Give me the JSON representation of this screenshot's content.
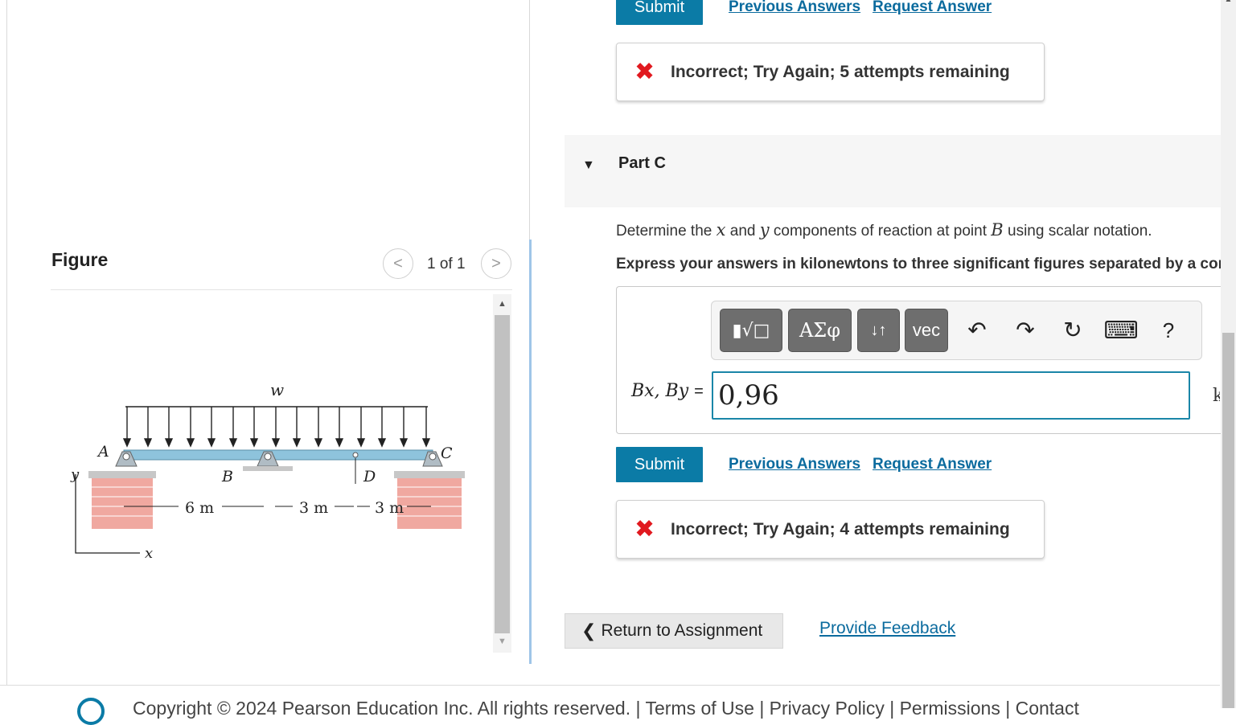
{
  "figure": {
    "title": "Figure",
    "counter": "1 of 1",
    "prev_icon": "<",
    "next_icon": ">",
    "diagram_labels": {
      "load": "w",
      "point_a": "A",
      "point_b": "B",
      "point_c": "C",
      "point_d": "D",
      "axis_y": "y",
      "axis_x": "x",
      "dim_1": "6 m",
      "dim_2": "3 m",
      "dim_3": "3 m"
    }
  },
  "part_b": {
    "submit_label": "Submit",
    "previous_answers": "Previous Answers",
    "request_answer": "Request Answer",
    "feedback_icon": "✖",
    "feedback_text": "Incorrect; Try Again; 5 attempts remaining"
  },
  "part_c": {
    "caret": "▼",
    "title": "Part C",
    "question_pre": "Determine the ",
    "var_x": "x",
    "question_and": " and ",
    "var_y": "y",
    "question_mid": " components of reaction at point ",
    "var_b": "B",
    "question_post": " using scalar notation.",
    "instruction": "Express your answers in kilonewtons to three significant figures separated by a comma.",
    "toolbar": {
      "templates_label": "▮√□",
      "greek_label": "ΑΣφ",
      "updown_label": "↓↑",
      "vec_label": "vec",
      "undo_icon": "↶",
      "redo_icon": "↷",
      "reset_icon": "↻",
      "keyboard_icon": "⌨",
      "help_label": "?"
    },
    "answer_label": "Bx, By",
    "answer_equals": "=",
    "answer_value": "0,96",
    "unit_partial": "k",
    "submit_label": "Submit",
    "previous_answers": "Previous Answers",
    "request_answer": "Request Answer",
    "feedback_icon": "✖",
    "feedback_text": "Incorrect; Try Again; 4 attempts remaining"
  },
  "bottom": {
    "return_label": "Return to Assignment",
    "return_icon": "❮",
    "provide_feedback": "Provide Feedback"
  },
  "footer": {
    "text": "Copyright © 2024 Pearson Education Inc. All rights reserved.  |  Terms of Use  |  Privacy Policy  |  Permissions  |  Contact"
  }
}
